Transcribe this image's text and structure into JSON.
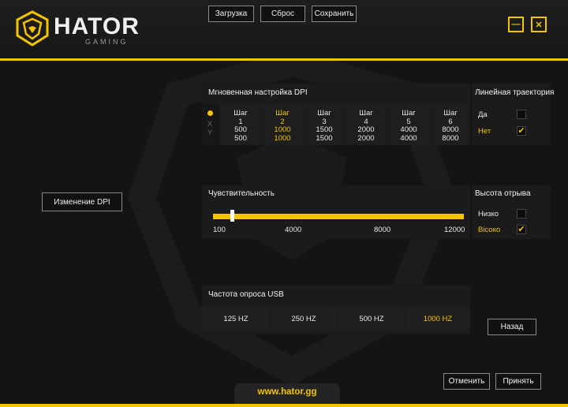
{
  "brand": {
    "name": "HATOR",
    "sub": "GAMING",
    "website": "www.hator.gg"
  },
  "toolbar": {
    "load": "Загрузка",
    "reset": "Сброс",
    "save": "Сохранить"
  },
  "window": {
    "minimize": "—",
    "close": "✕"
  },
  "sidebar": {
    "dpi_change": "Изменение DPI"
  },
  "dpi": {
    "title": "Мгновенная настройка DPI",
    "axes": [
      "X",
      "Y"
    ],
    "steps": [
      {
        "label": "Шаг",
        "num": "1",
        "x": "500",
        "y": "500"
      },
      {
        "label": "Шаг",
        "num": "2",
        "x": "1000",
        "y": "1000"
      },
      {
        "label": "Шаг",
        "num": "3",
        "x": "1500",
        "y": "1500"
      },
      {
        "label": "Шаг",
        "num": "4",
        "x": "2000",
        "y": "2000"
      },
      {
        "label": "Шаг",
        "num": "5",
        "x": "4000",
        "y": "4000"
      },
      {
        "label": "Шаг",
        "num": "6",
        "x": "8000",
        "y": "8000"
      }
    ],
    "active_step": 2
  },
  "trajectory": {
    "title": "Линейная траектория",
    "yes": "Да",
    "no": "Нет",
    "selected": "no"
  },
  "sensitivity": {
    "title": "Чувствительность",
    "ticks": [
      "100",
      "4000",
      "8000",
      "12000"
    ],
    "min": 100,
    "max": 12000,
    "value": 1000
  },
  "lift": {
    "title": "Высота отрыва",
    "low": "Низко",
    "high": "Вісоко",
    "selected": "high"
  },
  "usb": {
    "title": "Частота опроса USB",
    "rates": [
      "125 HZ",
      "250 HZ",
      "500 HZ",
      "1000 HZ"
    ],
    "selected": "1000 HZ"
  },
  "actions": {
    "back": "Назад",
    "cancel": "Отменить",
    "apply": "Принять"
  },
  "colors": {
    "accent": "#f5c400",
    "background": "#141414",
    "panel": "#1b1b1b"
  },
  "icons": {
    "logo": "hator-logo-icon",
    "check": "check-icon",
    "radio": "active-dot-icon"
  }
}
